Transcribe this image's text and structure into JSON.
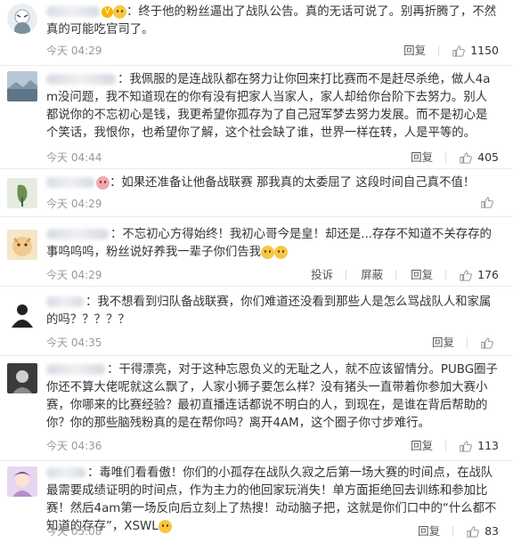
{
  "colors": {
    "username": "#eb7350",
    "meta": "#999999",
    "like_icon": "#999999",
    "badge": "#f7b500"
  },
  "icons": {
    "like": "thumbs-up-icon"
  },
  "comments": [
    {
      "text": "：终于他的粉丝逼出了战队公告。真的无话可说了。别再折腾了，不然真的可能吃官司了。",
      "time": "今天 04:29",
      "reply": "回复",
      "likes": "1150"
    },
    {
      "text": "：我佩服的是连战队都在努力让你回来打比赛而不是赶尽杀绝，做人4am没问题，我不知道现在的你有没有把家人当家人，家人却给你台阶下去努力。别人都说你的不忘初心是钱，我更希望你孤存为了自己冠军梦去努力发展。而不是初心是个笑话，我恨你，也希望你了解，这个社会缺了谁，世界一样在转，人是平等的。",
      "time": "今天 04:44",
      "reply": "回复",
      "likes": "405"
    },
    {
      "text": "：如果还准备让他备战联赛 那我真的太委屈了 这段时间自己真不值！",
      "time": "今天 04:29"
    },
    {
      "text": "：不忘初心方得始终！我初心哥今是皇！却还是...存存不知道不关存存的事呜呜呜，粉丝说好养我一辈子你们告我",
      "time": "今天 04:29",
      "report": "投诉",
      "block": "屏蔽",
      "reply": "回复",
      "likes": "176"
    },
    {
      "text": "：我不想看到归队备战联赛，你们难道还没看到那些人是怎么骂战队人和家属的吗？？？？？",
      "time": "今天 04:35",
      "reply": "回复"
    },
    {
      "text": "：干得漂亮，对于这种忘恩负义的无耻之人，就不应该留情分。PUBG圈子你还不算大佬呢就这么飘了，人家小狮子要怎么样？没有猪头一直带着你参加大赛小赛，你哪来的比赛经验？最初直播连话都说不明白的人，到现在，是谁在背后帮助的你？你的那些脑残粉真的是在帮你吗？离开4AM，这个圈子你寸步难行。",
      "time": "今天 04:36",
      "reply": "回复",
      "likes": "113"
    },
    {
      "text": "：毒唯们看看傲！你们的小孤存在战队久寂之后第一场大赛的时间点，在战队最需要成绩证明的时间点，作为主力的他回家玩消失！单方面拒绝回去训练和参加比赛！然后4am第一场反向后立刻上了热搜！动动脑子把，这就是你们口中的“什么都不知道的存存”，XSWL",
      "time": "今天 05:08",
      "reply": "回复",
      "likes": "83"
    }
  ]
}
